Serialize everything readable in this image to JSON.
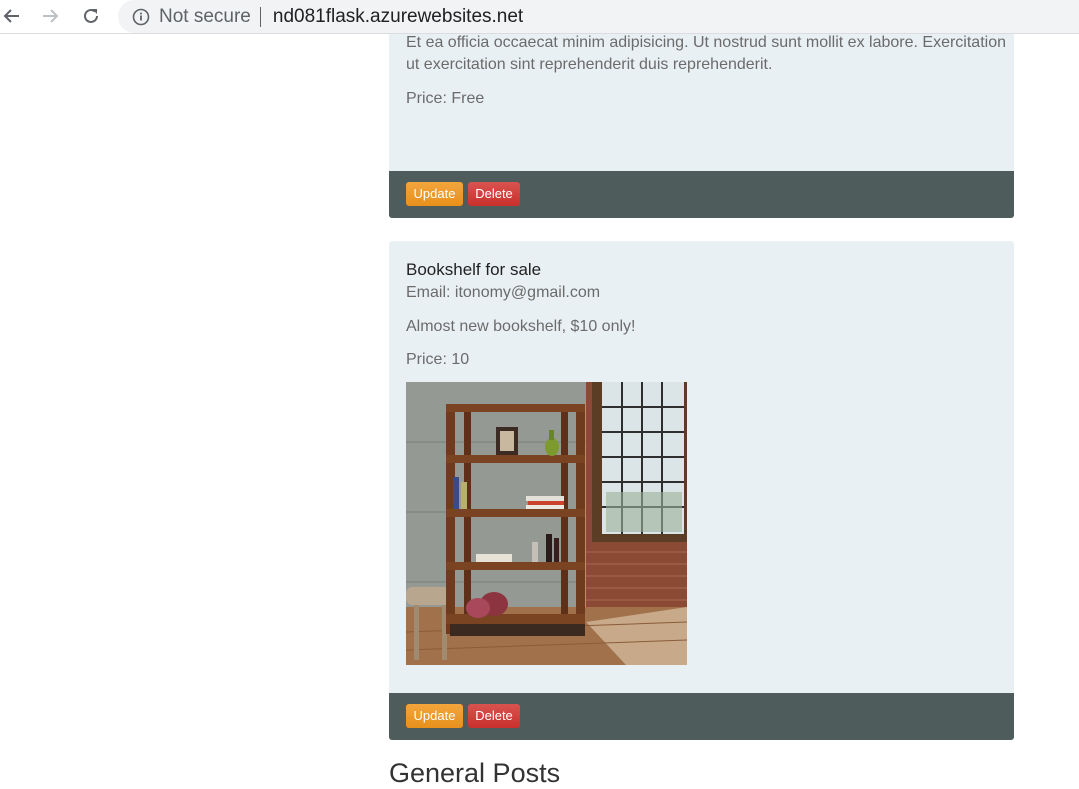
{
  "browser": {
    "security_label": "Not secure",
    "separator": "|",
    "url": "nd081flask.azurewebsites.net"
  },
  "post1": {
    "description_line1": "Et ea officia occaecat minim adipisicing. Ut nostrud sunt mollit ex labore. Exercitation",
    "description_line2": "ut exercitation sint reprehenderit duis reprehenderit.",
    "price": "Price: Free",
    "update_label": "Update",
    "delete_label": "Delete"
  },
  "post2": {
    "title": "Bookshelf for sale",
    "email": "Email: itonomy@gmail.com",
    "description": "Almost new bookshelf, $10 only!",
    "price": "Price: 10",
    "update_label": "Update",
    "delete_label": "Delete"
  },
  "sections": {
    "general_posts": "General Posts"
  },
  "icons": {
    "back": "arrow-left-icon",
    "forward": "arrow-right-icon",
    "reload": "reload-icon",
    "info": "info-icon"
  },
  "colors": {
    "card_bg": "#e9f0f4",
    "footer_bg": "#4e5c5c",
    "update_btn": "#ec971f",
    "delete_btn": "#d9534f"
  }
}
